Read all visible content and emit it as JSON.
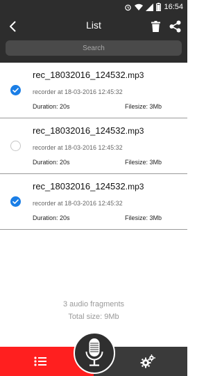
{
  "status_bar": {
    "time": "16:54"
  },
  "header": {
    "title": "List"
  },
  "search": {
    "placeholder": "Search"
  },
  "recordings": [
    {
      "name": "rec_18032016_124532",
      "ext": ".mp3",
      "meta": "recorder at 18-03-2016 12:45:32",
      "duration": "Duration: 20s",
      "filesize": "Filesize: 3Mb",
      "selected": true
    },
    {
      "name": "rec_18032016_124532",
      "ext": ".mp3",
      "meta": "recorder at 18-03-2016 12:45:32",
      "duration": "Duration: 20s",
      "filesize": "Filesize: 3Mb",
      "selected": false
    },
    {
      "name": "rec_18032016_124532",
      "ext": ".mp3",
      "meta": "recorder at 18-03-2016 12:45:32",
      "duration": "Duration: 20s",
      "filesize": "Filesize: 3Mb",
      "selected": true
    }
  ],
  "summary": {
    "count": "3 audio fragments",
    "total": "Total size: 9Mb"
  },
  "colors": {
    "accent": "#1a7ee6",
    "tab_active": "#ff1f1f",
    "bar": "#2d2d2d"
  },
  "icons": {
    "back": "chevron-left-icon",
    "delete": "trash-icon",
    "share": "share-icon",
    "list_tab": "list-icon",
    "record": "microphone-icon",
    "settings_tab": "gears-icon"
  }
}
